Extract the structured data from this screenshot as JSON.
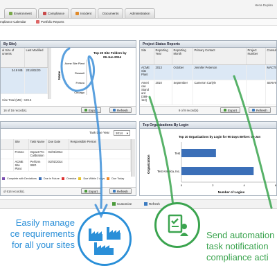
{
  "user": "Hena Duplan",
  "tabs": [
    {
      "label": "Environment",
      "color": "#7aa84a"
    },
    {
      "label": "Compliance",
      "color": "#c94a4a"
    },
    {
      "label": "Incident",
      "color": "#e08a2a"
    },
    {
      "label": "Documents",
      "color": ""
    },
    {
      "label": "Administration",
      "color": ""
    }
  ],
  "subnav": [
    "mpliance Calendar",
    "Portfolio Reports"
  ],
  "left_panel": {
    "title": "By Site)",
    "headers": [
      "al Size of uments",
      "Last Modified"
    ],
    "row": {
      "size": "34.9 MB",
      "date": "2014/02/20"
    },
    "size_total": "Size Total (MB) : 199.6",
    "footer": "16 of 16 record(s).",
    "chart": {
      "title": "Top 20 Site Folders by",
      "subtitle": "09-Jun-2014",
      "ylabel": "Name",
      "categories": [
        "Acme Site Plant",
        "Roswell",
        "Fresno",
        "Chicago"
      ]
    }
  },
  "project_panel": {
    "title": "Project Status Reports",
    "headers": [
      "Site",
      "Reporting Year",
      "Reporting Month",
      "Primary Contact",
      "Project Number",
      "Consulta"
    ],
    "rows": [
      [
        "ACME Site Plant",
        "2013",
        "October",
        "Jennifer Peterson",
        "",
        "MACTE"
      ],
      [
        "Ameri can Stand ard (389-112)",
        "2010",
        "September",
        "Cameron Carlyle",
        "",
        "SERVIC"
      ]
    ],
    "footer": "9 of 9 record(s)"
  },
  "task_panel": {
    "filter_label": "Task Due Year",
    "filter_value": "2014",
    "headers": [
      "Site",
      "Task Name",
      "Due Date",
      "Responsible Person"
    ],
    "rows": [
      [
        "Fresno",
        "Impact Pro Calibration",
        "01/01/2014",
        ""
      ],
      [
        "ACME Site Plant",
        "Perform SBO",
        "01/01/2014",
        ""
      ]
    ],
    "legend": [
      "Complete with Deviations",
      "Due in Future",
      "Overdue",
      "Due Within 2 days",
      "Due Today"
    ],
    "footer": "of 616 record(s)."
  },
  "org_panel": {
    "title": "Top Organizations By Login",
    "chart": {
      "title": "Top 10 Organizations by Login for 90 Days Before: 09-Jun",
      "ylabel": "Organization",
      "xlabel": "Number of Logins",
      "categories": [
        "Test",
        "Test America, Inc."
      ],
      "ticks": [
        "0",
        "2",
        "4",
        "6"
      ]
    }
  },
  "buttons": {
    "export": "Export",
    "refresh": "Refresh",
    "customize": "Customize"
  },
  "annotations": {
    "blue": [
      "Easily manage",
      "ce requirements",
      "for all your sites"
    ],
    "green": [
      "Send automation",
      "task notification",
      "compliance acti"
    ]
  },
  "colors": {
    "blue": "#2a8fd8",
    "green": "#3ba44f",
    "bar": "#3b6fb8"
  },
  "chart_data": [
    {
      "type": "bar",
      "title": "Top 20 Site Folders by",
      "subtitle": "09-Jun-2014",
      "ylabel": "Name",
      "categories": [
        "Acme Site Plant",
        "Roswell",
        "Fresno",
        "Chicago"
      ],
      "values": [
        0,
        0,
        0,
        0
      ]
    },
    {
      "type": "bar",
      "title": "Top 10 Organizations by Login for 90 Days Before: 09-Jun",
      "xlabel": "Number of Logins",
      "ylabel": "Organization",
      "categories": [
        "Test",
        "Test America, Inc."
      ],
      "values": [
        2.2,
        4.6
      ],
      "xlim": [
        0,
        6
      ]
    }
  ]
}
